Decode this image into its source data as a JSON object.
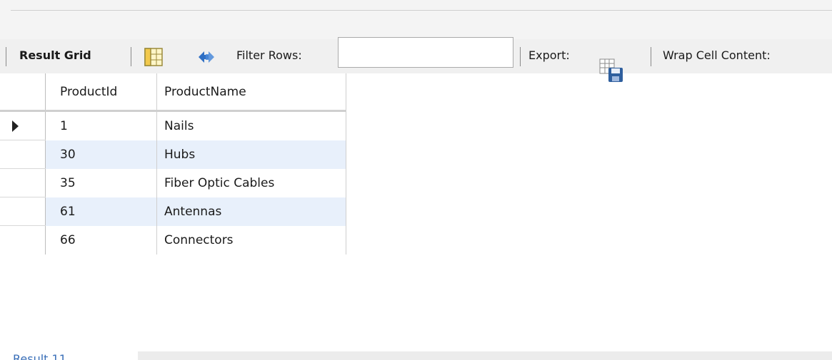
{
  "toolbar": {
    "result_grid_label": "Result Grid",
    "filter_rows_label": "Filter Rows:",
    "filter_rows_value": "",
    "export_label": "Export:",
    "wrap_cell_label": "Wrap Cell Content:",
    "icons": {
      "grid": "grid-view-icon",
      "refresh": "refresh-arrows-icon",
      "export": "export-grid-save-icon"
    }
  },
  "table": {
    "columns": [
      "ProductId",
      "ProductName"
    ],
    "rows": [
      {
        "ProductId": "1",
        "ProductName": "Nails",
        "current": true
      },
      {
        "ProductId": "30",
        "ProductName": "Hubs",
        "current": false
      },
      {
        "ProductId": "35",
        "ProductName": "Fiber Optic Cables",
        "current": false
      },
      {
        "ProductId": "61",
        "ProductName": "Antennas",
        "current": false
      },
      {
        "ProductId": "66",
        "ProductName": "Connectors",
        "current": false
      }
    ]
  },
  "bottom_tab_label": "Result 11",
  "colors": {
    "toolbar_bg": "#f0f0f0",
    "alt_row_bg": "#e8f0fb",
    "refresh_icon": "#2f6fc4"
  }
}
